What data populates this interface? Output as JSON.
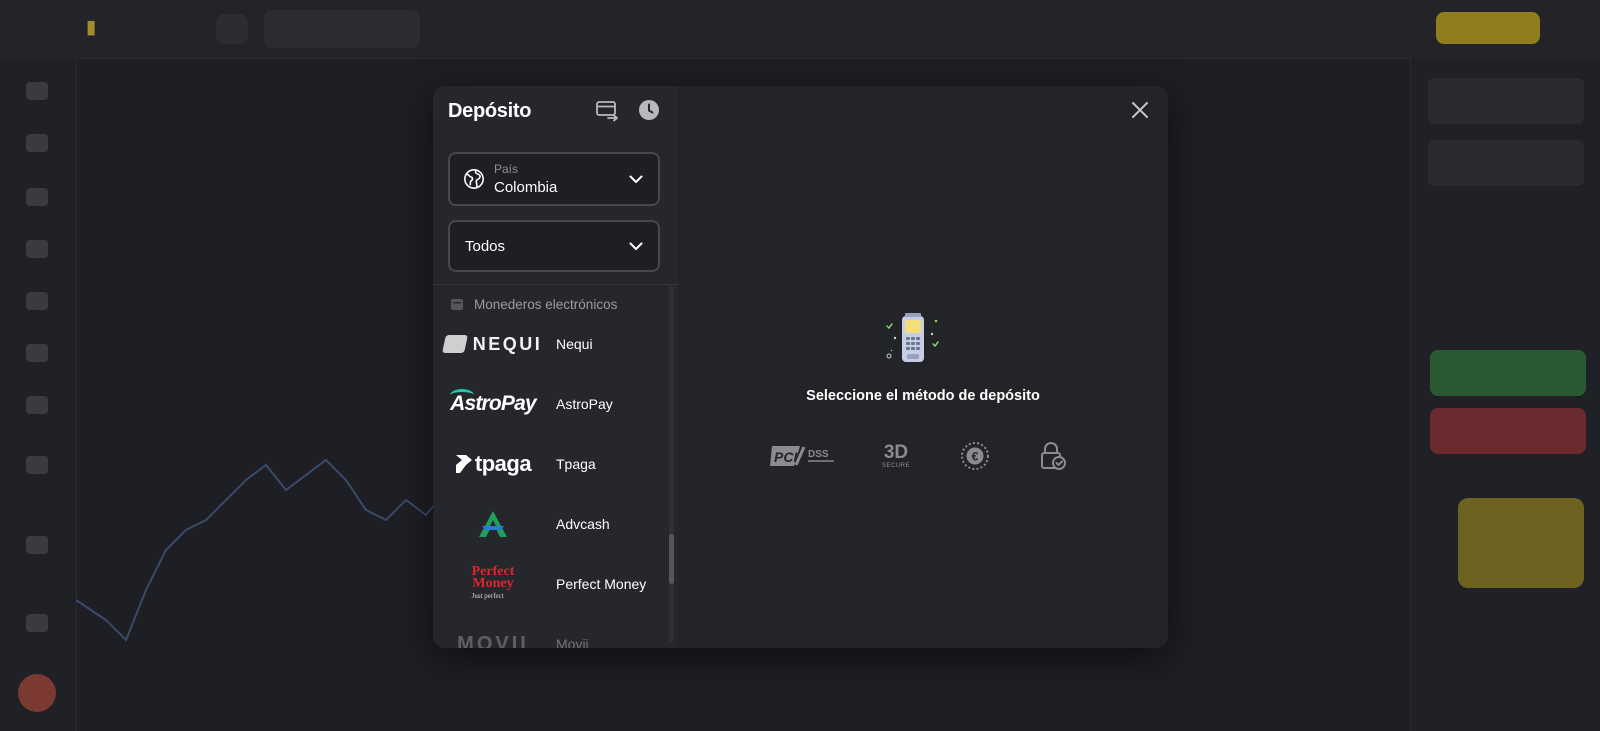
{
  "modal": {
    "title": "Depósito",
    "header_icons": [
      "card-transfer-icon",
      "clock-icon"
    ],
    "country_select": {
      "label": "País",
      "value": "Colombia"
    },
    "filter_select": {
      "value": "Todos"
    },
    "section_title": "Monederos electrónicos",
    "methods": [
      {
        "name": "Nequi",
        "logo_text": "NEQUI"
      },
      {
        "name": "AstroPay",
        "logo_text": "AstroPay"
      },
      {
        "name": "Tpaga",
        "logo_text": "tpaga"
      },
      {
        "name": "Advcash",
        "logo_text": ""
      },
      {
        "name": "Perfect Money",
        "logo_text": "Perfect Money",
        "logo_line1": "Perfect",
        "logo_line2": "Money",
        "logo_tagline": "Just perfect"
      },
      {
        "name": "Movii",
        "logo_text": "MOVII"
      }
    ],
    "empty_state_text": "Seleccione el método de depósito",
    "security_badges": {
      "pci": "PCI",
      "pci_dss": "DSS",
      "three_d": "3D",
      "three_d_sub": "SECURE",
      "euro": "€"
    }
  },
  "colors": {
    "modal_left_bg": "#26272d",
    "modal_right_bg": "#232428",
    "advcash_green": "#1fa05a",
    "advcash_blue": "#2a7bd6",
    "perfect_money_red": "#e2232b",
    "astropay_accent": "#1ec8a8"
  }
}
